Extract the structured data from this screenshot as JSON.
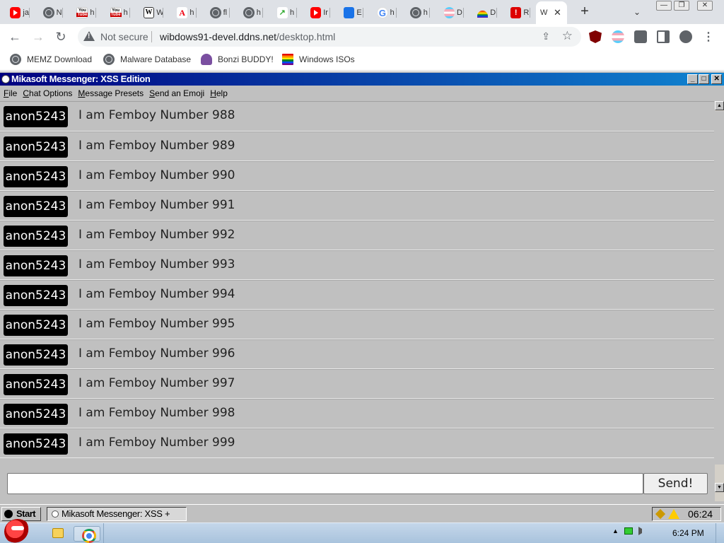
{
  "browser": {
    "tabs": [
      {
        "icon": "youtube-icon",
        "title": "ja"
      },
      {
        "icon": "globe-icon",
        "title": "N"
      },
      {
        "icon": "youtube-classic-icon",
        "title": "h"
      },
      {
        "icon": "youtube-classic-icon",
        "title": "h"
      },
      {
        "icon": "wikipedia-icon",
        "title": "W"
      },
      {
        "icon": "adobe-icon",
        "title": "h"
      },
      {
        "icon": "globe-icon",
        "title": "fl"
      },
      {
        "icon": "globe-icon",
        "title": "h"
      },
      {
        "icon": "chart-icon",
        "title": "h"
      },
      {
        "icon": "youtube-icon",
        "title": "Ir"
      },
      {
        "icon": "puzzle-icon",
        "title": "E"
      },
      {
        "icon": "google-icon",
        "title": "h"
      },
      {
        "icon": "globe-icon",
        "title": "h"
      },
      {
        "icon": "trans-flag-icon",
        "title": "D"
      },
      {
        "icon": "rainbow-icon",
        "title": "D"
      },
      {
        "icon": "alert-icon",
        "title": "R"
      }
    ],
    "active_tab": {
      "title": "W",
      "close": "✕"
    },
    "new_tab": "+",
    "tab_search": "⌄",
    "window_controls": {
      "minimize": "—",
      "restore": "❐",
      "close": "✕"
    },
    "nav": {
      "back": "←",
      "forward": "→",
      "reload": "↻"
    },
    "address": {
      "security": "Not secure",
      "host": "wibdows91-devel.ddns.net",
      "path": "/desktop.html",
      "share": "⇪",
      "bookmark": "☆"
    },
    "bookmarks": [
      {
        "icon": "globe-icon",
        "label": "MEMZ Download"
      },
      {
        "icon": "globe-icon",
        "label": "Malware Database"
      },
      {
        "icon": "bonzi-icon",
        "label": "Bonzi BUDDY!"
      },
      {
        "icon": "windows-flag-icon",
        "label": "Windows ISOs"
      }
    ]
  },
  "messenger": {
    "title": "Mikasoft Messenger: XSS Edition",
    "title_buttons": {
      "minimize": "_",
      "maximize": "□",
      "close": "✕"
    },
    "menu": [
      "File",
      "Chat Options",
      "Message Presets",
      "Send an Emoji",
      "Help"
    ],
    "messages": [
      {
        "user": "anon5243",
        "text": "I am Femboy Number 988"
      },
      {
        "user": "anon5243",
        "text": "I am Femboy Number 989"
      },
      {
        "user": "anon5243",
        "text": "I am Femboy Number 990"
      },
      {
        "user": "anon5243",
        "text": "I am Femboy Number 991"
      },
      {
        "user": "anon5243",
        "text": "I am Femboy Number 992"
      },
      {
        "user": "anon5243",
        "text": "I am Femboy Number 993"
      },
      {
        "user": "anon5243",
        "text": "I am Femboy Number 994"
      },
      {
        "user": "anon5243",
        "text": "I am Femboy Number 995"
      },
      {
        "user": "anon5243",
        "text": "I am Femboy Number 996"
      },
      {
        "user": "anon5243",
        "text": "I am Femboy Number 997"
      },
      {
        "user": "anon5243",
        "text": "I am Femboy Number 998"
      },
      {
        "user": "anon5243",
        "text": "I am Femboy Number 999"
      }
    ],
    "input": {
      "value": "",
      "placeholder": ""
    },
    "send_label": "Send!"
  },
  "win98_taskbar": {
    "start_label": "Start",
    "task_label": "Mikasoft Messenger: XSS +",
    "clock": "06:24"
  },
  "win7_taskbar": {
    "tray_arrow": "▲",
    "clock": "6:24 PM"
  }
}
